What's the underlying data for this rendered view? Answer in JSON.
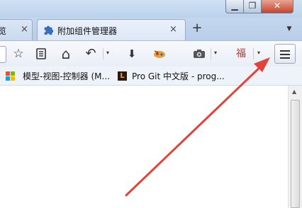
{
  "window": {
    "min_glyph": "▁",
    "max_glyph": "❐",
    "close_glyph": "✕"
  },
  "tabs": [
    {
      "label": "览",
      "close": "×"
    },
    {
      "label": "附加组件管理器",
      "close": "×",
      "icon": "puzzle-piece-icon"
    }
  ],
  "new_tab": "+",
  "tabs_list": "▼",
  "toolbar": {
    "icons": [
      "bookmark-star-icon",
      "reading-list-icon",
      "home-icon",
      "undo-back-icon",
      "download-icon",
      "extension-icon",
      "screenshot-camera-icon",
      "fu-extension-icon",
      "menu-hamburger-icon"
    ],
    "star": "☆",
    "home": "⌂",
    "undo": "↶",
    "download": "⬇",
    "camera": "📷",
    "fu": "福",
    "dropdown": "▾"
  },
  "bookmarks": [
    {
      "label": "模型-视图-控制器 (M...",
      "icon": "bookmark-favicon"
    },
    {
      "label": "Pro Git 中文版 - prog...",
      "icon": "pro-git-favicon",
      "icon_text": "L"
    }
  ],
  "colors": {
    "arrow": "#e0443a",
    "close_button": "#c7432b",
    "tab_active": "#eaf1fb"
  }
}
